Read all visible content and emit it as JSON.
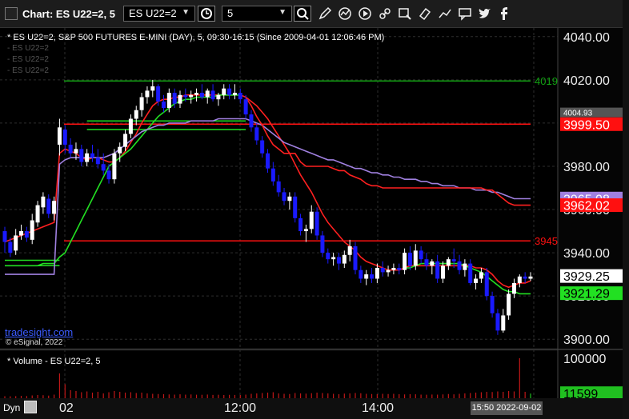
{
  "window": {
    "title": "Chart: ES U22=2, 5",
    "symbol_value": "ES U22=2",
    "interval_value": "5"
  },
  "toolbar": {
    "icons": [
      "clock-icon",
      "search-icon",
      "pencil-icon",
      "chart-line-icon",
      "play-icon",
      "link-icon",
      "eraser-icon",
      "speech-bubble-icon",
      "twitter-icon",
      "facebook-icon"
    ]
  },
  "chart_header": "* ES U22=2, S&P 500 FUTURES E-MINI (DAY), 5, 09:30-16:15 (Since 2009-04-01 12:06:46 PM)",
  "legend_rows": [
    "- ES U22=2",
    "- ES U22=2",
    "- ES U22=2"
  ],
  "volume_header": "* Volume - ES U22=2, 5",
  "watermark": "tradesight.com",
  "copyright": "© eSignal, 2022",
  "dyn_label": "Dyn",
  "date_readout": "15:50 2022-09-02",
  "colors": {
    "up": "#ffffff",
    "down": "#1a1aff",
    "ema_red": "#ff2020",
    "ema_green": "#22e022",
    "vwap": "#a080e0",
    "level_red": "#ff1010",
    "level_green": "#12a012",
    "volume": "#c01818",
    "volume_green": "#20c020"
  },
  "chart_data": {
    "type": "line",
    "title": "",
    "xlabel": "",
    "ylabel": "",
    "ylim": [
      3896,
      4044
    ],
    "xticks": [
      "02",
      "12:00",
      "14:00"
    ],
    "yticks": [
      "3900.00",
      "3920.00",
      "3940.00",
      "3960.00",
      "3980.00",
      "4000.00",
      "4020.00",
      "4040.00"
    ],
    "price_tags": [
      {
        "text": "4004.93",
        "value": 4004.93,
        "bg": "#555555",
        "fg": "#ffffff"
      },
      {
        "text": "3999.50",
        "value": 3999.5,
        "bg": "#ff1010",
        "fg": "#ffffff"
      },
      {
        "text": "3965.08",
        "value": 3965.08,
        "bg": "#a080e0",
        "fg": "#ffffff"
      },
      {
        "text": "3962.02",
        "value": 3962.02,
        "bg": "#ff1010",
        "fg": "#ffffff"
      },
      {
        "text": "3929.25",
        "value": 3929.25,
        "bg": "#ffffff",
        "fg": "#000000"
      },
      {
        "text": "3921.29",
        "value": 3921.29,
        "bg": "#22e022",
        "fg": "#000000"
      }
    ],
    "levels": [
      {
        "value": 4019.5,
        "label": "4019",
        "color": "#12a012"
      },
      {
        "value": 3999.5,
        "label": "",
        "color": "#ff1010"
      },
      {
        "value": 3945.5,
        "label": "3945",
        "color": "#ff1010"
      }
    ],
    "candles": [
      [
        3950,
        3952,
        3940,
        3945
      ],
      [
        3945,
        3947,
        3938,
        3940
      ],
      [
        3941,
        3951,
        3939,
        3948
      ],
      [
        3948,
        3953,
        3946,
        3950
      ],
      [
        3950,
        3952,
        3945,
        3947
      ],
      [
        3946,
        3958,
        3944,
        3955
      ],
      [
        3954,
        3964,
        3952,
        3962
      ],
      [
        3961,
        3968,
        3958,
        3966
      ],
      [
        3965,
        3967,
        3956,
        3958
      ],
      [
        3958,
        3966,
        3955,
        3964
      ],
      [
        3990,
        4002,
        3985,
        3998
      ],
      [
        3997,
        3999,
        3986,
        3990
      ],
      [
        3990,
        3993,
        3984,
        3986
      ],
      [
        3986,
        3991,
        3983,
        3988
      ],
      [
        3988,
        3990,
        3980,
        3982
      ],
      [
        3982,
        3988,
        3980,
        3986
      ],
      [
        3986,
        3990,
        3982,
        3984
      ],
      [
        3984,
        3988,
        3979,
        3981
      ],
      [
        3981,
        3986,
        3976,
        3978
      ],
      [
        3978,
        3981,
        3972,
        3974
      ],
      [
        3974,
        3988,
        3972,
        3986
      ],
      [
        3986,
        3991,
        3982,
        3989
      ],
      [
        3989,
        3997,
        3987,
        3995
      ],
      [
        3995,
        4004,
        3993,
        4002
      ],
      [
        4002,
        4008,
        3999,
        4006
      ],
      [
        4006,
        4014,
        4003,
        4012
      ],
      [
        4012,
        4017,
        4009,
        4015
      ],
      [
        4015,
        4020,
        4012,
        4017
      ],
      [
        4017,
        4018,
        4008,
        4010
      ],
      [
        4010,
        4013,
        4005,
        4007
      ],
      [
        4007,
        4016,
        4005,
        4014
      ],
      [
        4014,
        4016,
        4007,
        4009
      ],
      [
        4009,
        4015,
        4007,
        4013
      ],
      [
        4013,
        4016,
        4010,
        4012
      ],
      [
        4012,
        4015,
        4009,
        4013
      ],
      [
        4013,
        4016,
        4010,
        4014
      ],
      [
        4014,
        4018,
        4011,
        4012
      ],
      [
        4012,
        4016,
        4009,
        4015
      ],
      [
        4015,
        4018,
        4010,
        4011
      ],
      [
        4011,
        4014,
        4008,
        4013
      ],
      [
        4013,
        4018,
        4011,
        4016
      ],
      [
        4016,
        4018,
        4011,
        4013
      ],
      [
        4013,
        4018,
        4011,
        4014
      ],
      [
        4014,
        4016,
        4009,
        4011
      ],
      [
        4011,
        4013,
        4002,
        4004
      ],
      [
        4004,
        4006,
        3996,
        3998
      ],
      [
        3998,
        4000,
        3990,
        3992
      ],
      [
        3992,
        3994,
        3984,
        3986
      ],
      [
        3986,
        3988,
        3977,
        3979
      ],
      [
        3979,
        3982,
        3971,
        3973
      ],
      [
        3973,
        3976,
        3966,
        3968
      ],
      [
        3968,
        3970,
        3962,
        3964
      ],
      [
        3964,
        3968,
        3960,
        3966
      ],
      [
        3966,
        3968,
        3954,
        3956
      ],
      [
        3956,
        3958,
        3948,
        3950
      ],
      [
        3950,
        3953,
        3945,
        3951
      ],
      [
        3951,
        3962,
        3949,
        3959
      ],
      [
        3959,
        3961,
        3946,
        3948
      ],
      [
        3948,
        3950,
        3938,
        3940
      ],
      [
        3940,
        3942,
        3935,
        3937
      ],
      [
        3937,
        3940,
        3934,
        3938
      ],
      [
        3938,
        3940,
        3932,
        3935
      ],
      [
        3935,
        3941,
        3933,
        3939
      ],
      [
        3939,
        3946,
        3936,
        3943
      ],
      [
        3943,
        3945,
        3930,
        3932
      ],
      [
        3932,
        3934,
        3926,
        3928
      ],
      [
        3928,
        3932,
        3925,
        3930
      ],
      [
        3930,
        3933,
        3926,
        3928
      ],
      [
        3928,
        3935,
        3926,
        3933
      ],
      [
        3933,
        3936,
        3929,
        3931
      ],
      [
        3931,
        3934,
        3929,
        3932
      ],
      [
        3932,
        3935,
        3930,
        3933
      ],
      [
        3933,
        3935,
        3930,
        3932
      ],
      [
        3932,
        3942,
        3930,
        3940
      ],
      [
        3940,
        3943,
        3932,
        3934
      ],
      [
        3934,
        3944,
        3932,
        3941
      ],
      [
        3941,
        3943,
        3935,
        3937
      ],
      [
        3937,
        3940,
        3932,
        3934
      ],
      [
        3934,
        3937,
        3930,
        3936
      ],
      [
        3936,
        3939,
        3926,
        3928
      ],
      [
        3928,
        3936,
        3926,
        3934
      ],
      [
        3934,
        3938,
        3932,
        3937
      ],
      [
        3937,
        3942,
        3933,
        3936
      ],
      [
        3936,
        3939,
        3930,
        3932
      ],
      [
        3932,
        3937,
        3929,
        3935
      ],
      [
        3935,
        3937,
        3925,
        3926
      ],
      [
        3926,
        3930,
        3923,
        3928
      ],
      [
        3928,
        3933,
        3926,
        3931
      ],
      [
        3931,
        3933,
        3918,
        3920
      ],
      [
        3920,
        3922,
        3910,
        3912
      ],
      [
        3912,
        3914,
        3902,
        3904
      ],
      [
        3904,
        3914,
        3903,
        3911
      ],
      [
        3911,
        3923,
        3909,
        3921
      ],
      [
        3921,
        3928,
        3919,
        3926
      ],
      [
        3926,
        3930,
        3924,
        3929
      ],
      [
        3929,
        3931,
        3926,
        3928
      ],
      [
        3928,
        3931,
        3927,
        3929
      ]
    ],
    "series": [
      {
        "name": "",
        "color": "#ff2020",
        "values": [
          3945,
          3946,
          3947,
          3948,
          3949,
          3950,
          3951,
          3952,
          3953,
          3954,
          3986,
          3988,
          3987,
          3986,
          3984,
          3983,
          3984,
          3984,
          3983,
          3982,
          3982,
          3984,
          3987,
          3991,
          3995,
          4000,
          4004,
          4008,
          4010,
          4011,
          4011,
          4012,
          4012,
          4013,
          4013,
          4013,
          4013,
          4013,
          4013,
          4013,
          4013,
          4013,
          4013,
          4013,
          4012,
          4010,
          4008,
          4005,
          4002,
          3998,
          3994,
          3990,
          3986,
          3981,
          3976,
          3972,
          3968,
          3963,
          3958,
          3954,
          3951,
          3948,
          3945,
          3943,
          3941,
          3938,
          3936,
          3935,
          3934,
          3933,
          3932,
          3932,
          3932,
          3933,
          3934,
          3934,
          3934,
          3934,
          3934,
          3934,
          3934,
          3934,
          3934,
          3934,
          3934,
          3934,
          3933,
          3933,
          3932,
          3930,
          3927,
          3925,
          3924,
          3925,
          3926,
          3926,
          3927
        ]
      },
      {
        "name": "",
        "color": "#22e022",
        "values": [
          3934,
          3934,
          3934,
          3934,
          3934,
          3934,
          3934,
          3935,
          3935,
          3935,
          3938,
          3940,
          3945,
          3950,
          3955,
          3960,
          3965,
          3970,
          3975,
          3980,
          3982,
          3984,
          3986,
          3988,
          3991,
          3994,
          3997,
          4000,
          4003,
          4005,
          4007,
          4009,
          4010,
          4011,
          4011,
          4012,
          4012,
          4012,
          4012,
          4013,
          4013,
          4013,
          4013,
          4013,
          null,
          null,
          null,
          null,
          null,
          null,
          null,
          null,
          null,
          null,
          null,
          null,
          null,
          null,
          null,
          null,
          null,
          null,
          null,
          null,
          null,
          null,
          null,
          null,
          null,
          null,
          null,
          null,
          null,
          3933,
          3933,
          3934,
          3935,
          3935,
          3935,
          3935,
          3935,
          3935,
          3935,
          3935,
          3934,
          3933,
          3932,
          3931,
          3929,
          3927,
          3925,
          3923,
          3922,
          3922,
          3921,
          3921,
          3921
        ]
      },
      {
        "name": "",
        "color": "#a080e0",
        "values": [
          3930,
          3930,
          3930,
          3930,
          3930,
          3930,
          3930,
          3930,
          3930,
          3930,
          3981,
          3983,
          3984,
          3984,
          3984,
          3984,
          3984,
          3984,
          3984,
          3985,
          3986,
          3988,
          3990,
          3992,
          3994,
          3996,
          3997,
          3998,
          3999,
          3999,
          4000,
          4000,
          4000,
          4000,
          4001,
          4001,
          4001,
          4001,
          4001,
          4002,
          4002,
          4002,
          4002,
          4002,
          4002,
          4001,
          4000,
          3999,
          3997,
          3995,
          3993,
          3991,
          3990,
          3989,
          3988,
          3987,
          3986,
          3985,
          3984,
          3983,
          3983,
          3982,
          3981,
          3980,
          3979,
          3979,
          3978,
          3977,
          3977,
          3976,
          3976,
          3975,
          3975,
          3974,
          3974,
          3974,
          3973,
          3973,
          3972,
          3972,
          3971,
          3971,
          3971,
          3970,
          3970,
          3970,
          3969,
          3969,
          3969,
          3968,
          3968,
          3967,
          3966,
          3965,
          3965,
          3965,
          3965
        ]
      },
      {
        "name": "",
        "color": "#ff2020",
        "values": [
          null,
          null,
          null,
          null,
          null,
          null,
          null,
          null,
          null,
          null,
          null,
          null,
          null,
          null,
          null,
          null,
          null,
          null,
          null,
          null,
          null,
          null,
          null,
          null,
          null,
          null,
          null,
          null,
          null,
          null,
          null,
          null,
          null,
          null,
          null,
          null,
          null,
          null,
          null,
          null,
          null,
          null,
          null,
          null,
          4012,
          4008,
          4003,
          3999,
          3994,
          3990,
          3988,
          3986,
          3986,
          3986,
          3982,
          3980,
          3980,
          3980,
          3980,
          3980,
          3979,
          3978,
          3978,
          3976,
          3975,
          3974,
          3972,
          3971,
          3971,
          3970,
          3970,
          3970,
          3970,
          3970,
          3970,
          3970,
          3970,
          3970,
          3970,
          3970,
          3970,
          3970,
          3970,
          3970,
          3970,
          3970,
          3970,
          3970,
          3969,
          3969,
          3967,
          3965,
          3963,
          3962,
          3962,
          3962,
          3962
        ]
      }
    ],
    "green_levels": [
      {
        "value": 3936.5,
        "start": 0,
        "end": 10
      },
      {
        "value": 3934,
        "start": 0,
        "end": 10
      },
      {
        "value": 4001,
        "start": 15,
        "end": 44
      },
      {
        "value": 3997,
        "start": 15,
        "end": 44
      }
    ],
    "volume": {
      "ylim": [
        0,
        118000
      ],
      "yticks": [
        "100000"
      ],
      "last_tag": "11599",
      "last_value": 11599,
      "values": [
        5000,
        4800,
        5200,
        6000,
        5500,
        7000,
        8000,
        7500,
        6500,
        9000,
        62000,
        35000,
        20000,
        18000,
        15000,
        17000,
        14000,
        16000,
        12000,
        15000,
        18000,
        16000,
        14000,
        15000,
        13000,
        14000,
        12000,
        11000,
        10500,
        10000,
        9500,
        9000,
        9800,
        8900,
        9400,
        8800,
        8600,
        9200,
        8300,
        8700,
        8100,
        8500,
        8200,
        8000,
        9000,
        11000,
        12000,
        13000,
        14000,
        15000,
        12000,
        11000,
        10500,
        13000,
        12000,
        11500,
        12500,
        14000,
        13000,
        12000,
        11000,
        10000,
        11500,
        12000,
        13000,
        12500,
        11000,
        10500,
        10000,
        11000,
        10500,
        11000,
        10000,
        9500,
        10000,
        9800,
        9000,
        8800,
        9200,
        9000,
        9500,
        10500,
        9700,
        11000,
        12000,
        13000,
        14000,
        15000,
        16000,
        15500,
        17000,
        16000,
        18000,
        17000,
        100000,
        16000,
        11599
      ]
    }
  }
}
